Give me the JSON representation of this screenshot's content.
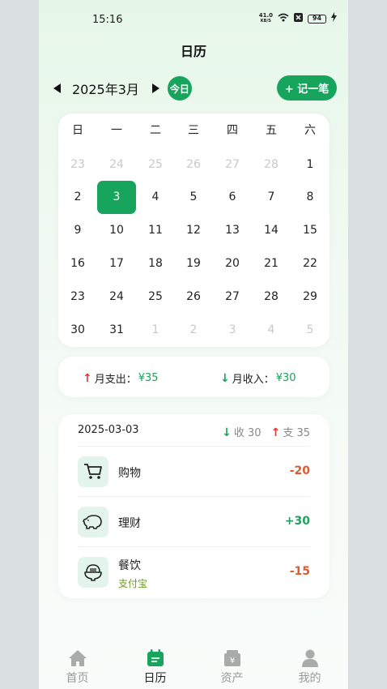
{
  "status_bar": {
    "time": "15:16",
    "net_speed": "41.0",
    "net_unit": "KB/S",
    "battery": "94"
  },
  "page_title": "日历",
  "month_nav": {
    "label": "2025年3月",
    "today_label": "今日",
    "add_label": "+ 记一笔"
  },
  "calendar": {
    "weekdays": [
      "日",
      "一",
      "二",
      "三",
      "四",
      "五",
      "六"
    ],
    "days": [
      {
        "d": "23",
        "dim": true
      },
      {
        "d": "24",
        "dim": true
      },
      {
        "d": "25",
        "dim": true
      },
      {
        "d": "26",
        "dim": true
      },
      {
        "d": "27",
        "dim": true
      },
      {
        "d": "28",
        "dim": true
      },
      {
        "d": "1"
      },
      {
        "d": "2"
      },
      {
        "d": "3",
        "selected": true
      },
      {
        "d": "4"
      },
      {
        "d": "5"
      },
      {
        "d": "6"
      },
      {
        "d": "7"
      },
      {
        "d": "8"
      },
      {
        "d": "9"
      },
      {
        "d": "10"
      },
      {
        "d": "11"
      },
      {
        "d": "12"
      },
      {
        "d": "13"
      },
      {
        "d": "14"
      },
      {
        "d": "15"
      },
      {
        "d": "16"
      },
      {
        "d": "17"
      },
      {
        "d": "18"
      },
      {
        "d": "19"
      },
      {
        "d": "20"
      },
      {
        "d": "21"
      },
      {
        "d": "22"
      },
      {
        "d": "23"
      },
      {
        "d": "24"
      },
      {
        "d": "25"
      },
      {
        "d": "26"
      },
      {
        "d": "27"
      },
      {
        "d": "28"
      },
      {
        "d": "29"
      },
      {
        "d": "30"
      },
      {
        "d": "31"
      },
      {
        "d": "1",
        "dim": true
      },
      {
        "d": "2",
        "dim": true
      },
      {
        "d": "3",
        "dim": true
      },
      {
        "d": "4",
        "dim": true
      },
      {
        "d": "5",
        "dim": true
      }
    ]
  },
  "summary": {
    "expense_label": "月支出：",
    "expense_value": "¥35",
    "income_label": "月收入：",
    "income_value": "¥30"
  },
  "day_detail": {
    "date": "2025-03-03",
    "income": "收 30",
    "expense": "支 35",
    "transactions": [
      {
        "name": "购物",
        "sub": "",
        "amount": "-20",
        "icon": "cart-icon"
      },
      {
        "name": "理财",
        "sub": "",
        "amount": "+30",
        "icon": "piggy-bank-icon"
      },
      {
        "name": "餐饮",
        "sub": "支付宝",
        "amount": "-15",
        "icon": "rice-bowl-icon"
      }
    ]
  },
  "nav": [
    {
      "label": "首页",
      "icon": "home-icon"
    },
    {
      "label": "日历",
      "icon": "calendar-icon"
    },
    {
      "label": "资产",
      "icon": "wallet-icon"
    },
    {
      "label": "我的",
      "icon": "user-icon"
    }
  ],
  "colors": {
    "accent": "#17a55e",
    "expense": "#e2582b",
    "income": "#1aa35a"
  }
}
